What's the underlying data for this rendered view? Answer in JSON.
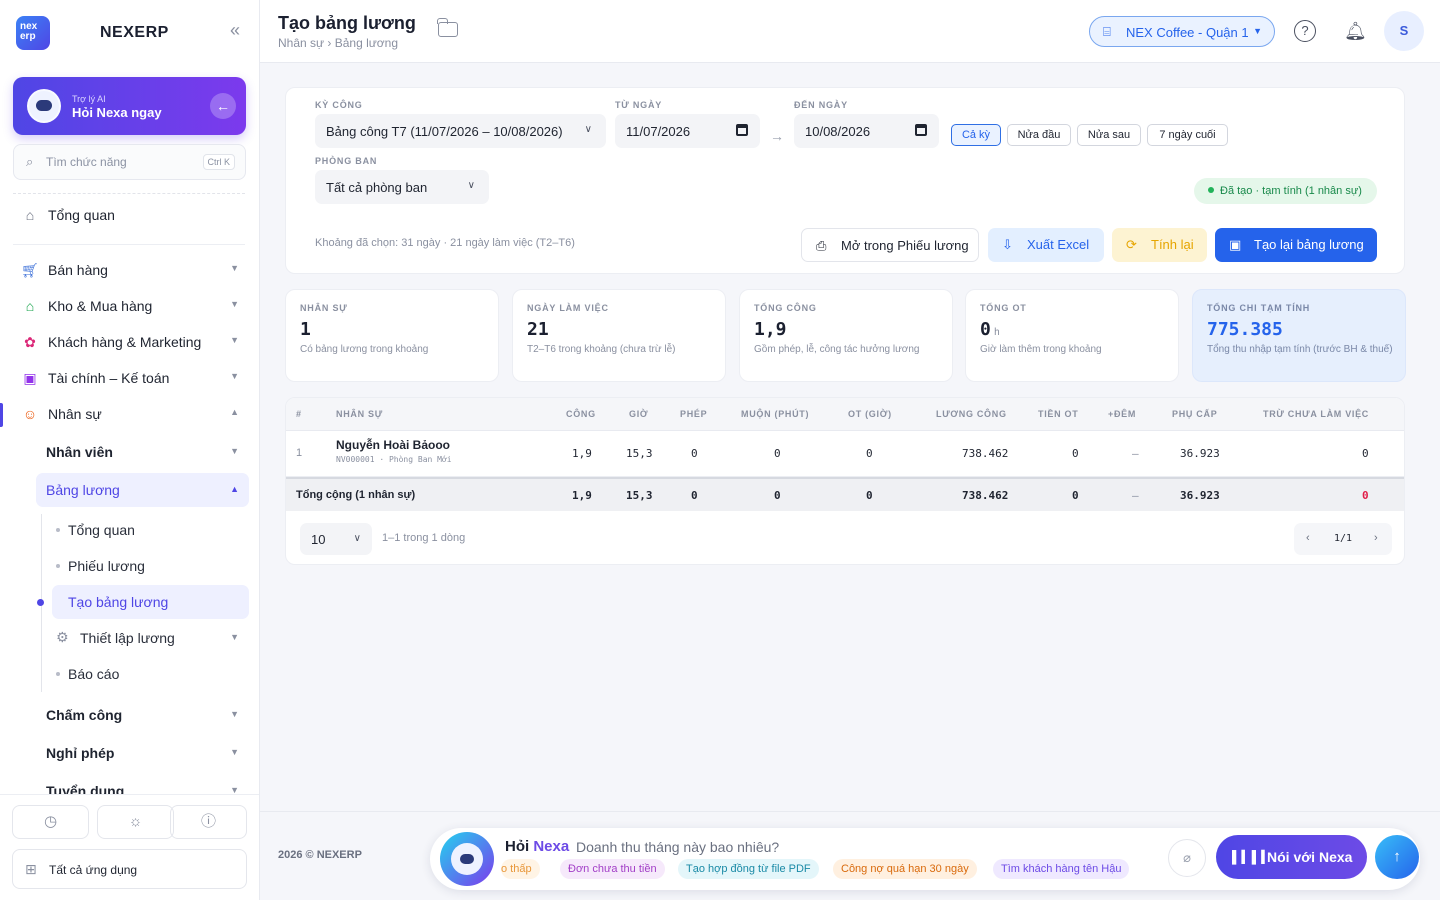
{
  "brand": {
    "logo_text": "nex erp",
    "name": "NEXERP"
  },
  "ai_card": {
    "small": "Trợ lý AI",
    "big": "Hỏi Nexa ngay"
  },
  "search": {
    "placeholder": "Tìm chức năng",
    "shortcut": "Ctrl K"
  },
  "nav": {
    "overview": "Tổng quan",
    "sales": "Bán hàng",
    "warehouse": "Kho & Mua hàng",
    "customers": "Khách hàng & Marketing",
    "finance": "Tài chính – Kế toán",
    "hr": "Nhân sự",
    "hr_sub": {
      "employees": "Nhân viên",
      "payroll": "Bảng lương",
      "payroll_children": [
        "Tổng quan",
        "Phiếu lương",
        "Tạo bảng lương",
        "Thiết lập lương",
        "Báo cáo"
      ],
      "attendance": "Chấm công",
      "leave": "Nghỉ phép",
      "recruit": "Tuyển dụng"
    }
  },
  "side_bottom": {
    "all_apps": "Tất cả ứng dụng"
  },
  "header": {
    "title": "Tạo bảng lương",
    "breadcrumb": "Nhân sự › Bảng lương",
    "store": "NEX Coffee - Quận 1",
    "avatar": "S"
  },
  "filters": {
    "period_label": "KỲ CÔNG",
    "period_value": "Bảng công T7 (11/07/2026 – 10/08/2026)",
    "from_label": "TỪ NGÀY",
    "from_value": "11/07/2026",
    "to_label": "ĐẾN NGÀY",
    "to_value": "10/08/2026",
    "chips": [
      "Cả kỳ",
      "Nửa đầu",
      "Nửa sau",
      "7 ngày cuối"
    ],
    "dept_label": "PHÒNG BAN",
    "dept_value": "Tất cả phòng ban",
    "status": "Đã tạo · tạm tính (1 nhân sự)",
    "range_note": "Khoảng đã chọn: 31 ngày · 21 ngày làm việc (T2–T6)",
    "btn_open": "Mở trong Phiếu lương",
    "btn_excel": "Xuất Excel",
    "btn_recalc": "Tính lại",
    "btn_regen": "Tạo lại bảng lương"
  },
  "stats": [
    {
      "title": "NHÂN SỰ",
      "value": "1",
      "unit": "",
      "sub": "Có bảng lương trong khoảng"
    },
    {
      "title": "NGÀY LÀM VIỆC",
      "value": "21",
      "unit": "",
      "sub": "T2–T6 trong khoảng (chưa trừ lễ)"
    },
    {
      "title": "TỔNG CÔNG",
      "value": "1,9",
      "unit": "",
      "sub": "Gồm phép, lễ, công tác hưởng lương"
    },
    {
      "title": "TỔNG OT",
      "value": "0",
      "unit": "h",
      "sub": "Giờ làm thêm trong khoảng"
    },
    {
      "title": "TỔNG CHI TẠM TÍNH",
      "value": "775.385",
      "unit": "",
      "sub": "Tổng thu nhập tạm tính (trước BH & thuế)"
    }
  ],
  "table": {
    "headers": [
      "#",
      "NHÂN SỰ",
      "CÔNG",
      "GIỜ",
      "PHÉP",
      "MUỘN (PHÚT)",
      "OT (GIỜ)",
      "LƯƠNG CÔNG",
      "TIỀN OT",
      "+ĐÊM",
      "PHỤ CẤP",
      "TRỪ CHƯA LÀM VIỆC"
    ],
    "row": {
      "idx": "1",
      "name": "Nguyễn Hoài Bảooo",
      "meta": "NV000001 · Phòng Ban Mới",
      "cong": "1,9",
      "gio": "15,3",
      "phep": "0",
      "muon": "0",
      "ot": "0",
      "luong": "738.462",
      "tienot": "0",
      "dem": "–",
      "phucap": "36.923",
      "tru": "0"
    },
    "total": {
      "label": "Tổng cộng (1 nhân sự)",
      "cong": "1,9",
      "gio": "15,3",
      "phep": "0",
      "muon": "0",
      "ot": "0",
      "luong": "738.462",
      "tienot": "0",
      "dem": "–",
      "phucap": "36.923",
      "tru": "0"
    },
    "page_size": "10",
    "page_info": "1–1 trong 1 dòng",
    "page": "1/1"
  },
  "footer": {
    "copyright": "2026 © NEXERP",
    "ask_prefix": "Hỏi",
    "ask_brand": "Nexa",
    "question": "Doanh thu tháng này bao nhiêu?",
    "suggestions": [
      "o thấp",
      "Đơn chưa thu tiền",
      "Tạo hợp đồng từ file PDF",
      "Công nợ quá hạn 30 ngày",
      "Tìm khách hàng tên Hậu"
    ],
    "voice": "Nói với Nexa"
  },
  "colors": {
    "accent": "#4f46e5",
    "primary": "#2563eb",
    "success": "#18894a",
    "warning": "#f59e0b",
    "danger": "#e11d48"
  }
}
